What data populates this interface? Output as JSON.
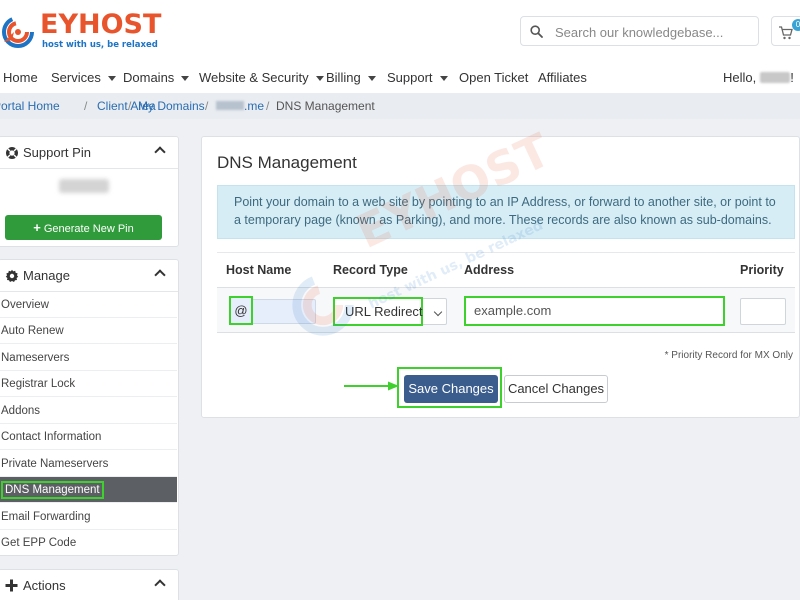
{
  "brand": {
    "name": "EYHOST",
    "logo_word": "EYHOST",
    "tagline": "host with us, be relaxed",
    "color_primary": "#e8542b",
    "color_secondary": "#1d74c4"
  },
  "header": {
    "search_placeholder": "Search our knowledgebase...",
    "search_icon": "search-icon",
    "cart_icon": "cart-icon",
    "cart_count": "0"
  },
  "nav": {
    "items": [
      {
        "label": "Home"
      },
      {
        "label": "Services"
      },
      {
        "label": "Domains"
      },
      {
        "label": "Website & Security"
      },
      {
        "label": "Billing"
      },
      {
        "label": "Support"
      },
      {
        "label": "Open Ticket"
      },
      {
        "label": "Affiliates"
      }
    ],
    "hello": "Hello,",
    "hello_suffix": "!"
  },
  "breadcrumb": {
    "items": [
      "Portal Home",
      "Client Area",
      "My Domains",
      ".me",
      "DNS Management"
    ],
    "separator": "/"
  },
  "sidebar": {
    "support_pin": {
      "title": "Support Pin",
      "button": "Generate New Pin"
    },
    "manage": {
      "title": "Manage",
      "items": [
        {
          "label": "Overview"
        },
        {
          "label": "Auto Renew"
        },
        {
          "label": "Nameservers"
        },
        {
          "label": "Registrar Lock"
        },
        {
          "label": "Addons"
        },
        {
          "label": "Contact Information"
        },
        {
          "label": "Private Nameservers"
        },
        {
          "label": "DNS Management"
        },
        {
          "label": "Email Forwarding"
        },
        {
          "label": "Get EPP Code"
        }
      ],
      "active": "DNS Management"
    },
    "actions": {
      "title": "Actions"
    }
  },
  "main": {
    "title": "DNS Management",
    "info": "Point your domain to a web site by pointing to an IP Address, or forward to another site, or point to a temporary page (known as Parking), and more. These records are also known as sub-domains.",
    "columns": {
      "host": "Host Name",
      "type": "Record Type",
      "address": "Address",
      "priority": "Priority"
    },
    "record": {
      "host": "@",
      "type": "URL Redirect",
      "address_placeholder": "example.com",
      "priority": ""
    },
    "priority_note": "* Priority Record for MX Only",
    "save_label": "Save Changes",
    "cancel_label": "Cancel Changes"
  },
  "highlight_color": "#3ed12e"
}
